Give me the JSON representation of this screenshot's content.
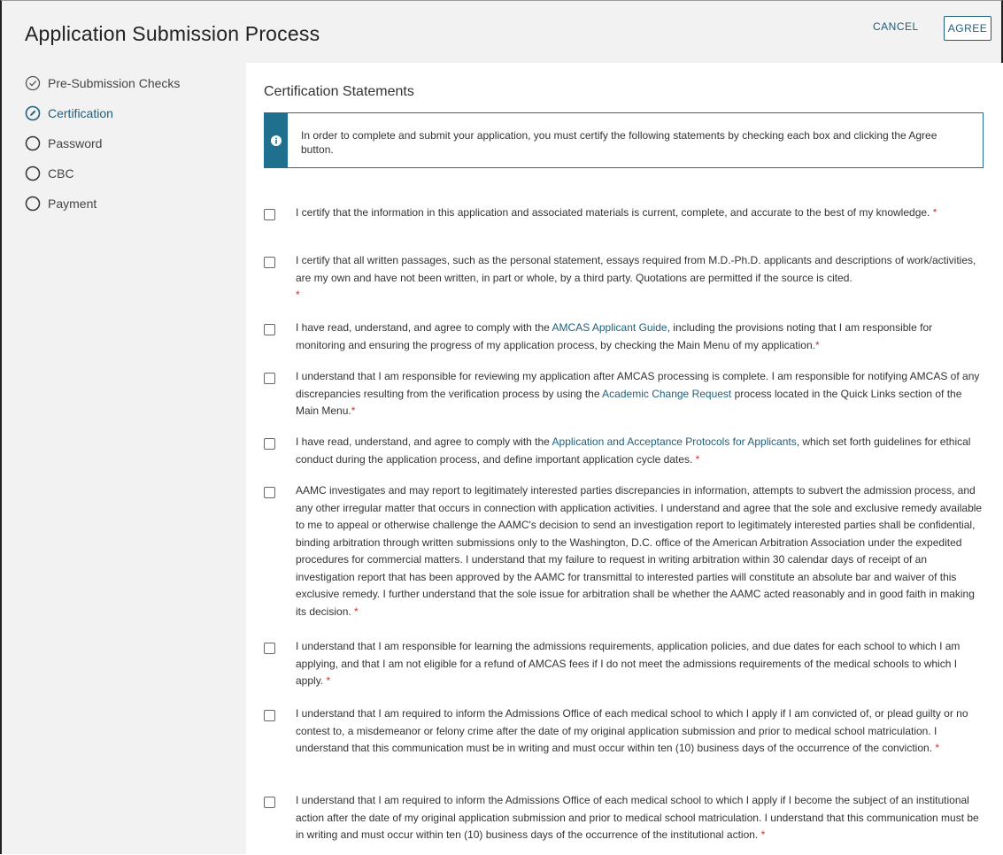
{
  "header": {
    "title": "Application Submission Process",
    "cancel_label": "CANCEL",
    "agree_label": "AGREE"
  },
  "sidebar": {
    "steps": [
      {
        "label": "Pre-Submission Checks",
        "state": "complete",
        "icon": "check-circle-icon"
      },
      {
        "label": "Certification",
        "state": "current",
        "icon": "pencil-circle-icon"
      },
      {
        "label": "Password",
        "state": "pending",
        "icon": "circle-icon"
      },
      {
        "label": "CBC",
        "state": "pending",
        "icon": "circle-icon"
      },
      {
        "label": "Payment",
        "state": "pending",
        "icon": "circle-icon"
      }
    ]
  },
  "main": {
    "section_title": "Certification Statements",
    "info_icon": "info-icon",
    "info_text": "In order to complete and submit your application, you must certify the following statements by checking each box and clicking the Agree button.",
    "required_mark": "*",
    "statements": [
      {
        "text": "I certify that the information in this application and associated materials is current, complete, and accurate to the best of my knowledge. ",
        "checked": false
      },
      {
        "text": "I certify that all written passages, such as the personal statement, essays required from M.D.-Ph.D. applicants and descriptions of work/activities, are my own and have not been written, in part or whole, by a third party. Quotations are permitted if the source is cited. ",
        "checked": false
      },
      {
        "text_before": "I have read, understand, and agree to comply with the ",
        "link": "AMCAS Applicant Guide",
        "text_after": ", including the provisions noting that I am responsible for monitoring and ensuring the progress of my application process, by checking the Main Menu of my application.",
        "checked": false
      },
      {
        "text_before": "I understand that I am responsible for reviewing my application after AMCAS processing is complete. I am responsible for notifying AMCAS of any discrepancies resulting from the verification process by using the ",
        "link": "Academic Change Request",
        "text_after": " process located in the Quick Links section of the Main Menu.",
        "checked": false
      },
      {
        "text_before": "I have read, understand, and agree to comply with the ",
        "link": "Application and Acceptance Protocols for Applicants",
        "text_after": ", which set forth guidelines for ethical conduct during the application process, and define important application cycle dates. ",
        "checked": false
      },
      {
        "text": "AAMC investigates and may report to legitimately interested parties discrepancies in information, attempts to subvert the admission process, and any other irregular matter that occurs in connection with application activities. I understand and agree that the sole and exclusive remedy available to me to appeal or otherwise challenge the AAMC's decision to send an investigation report to legitimately interested parties shall be confidential, binding arbitration through written submissions only to the Washington, D.C. office of the American Arbitration Association under the expedited procedures for commercial matters. I understand that my failure to request in writing arbitration within 30 calendar days of receipt of an investigation report that has been approved by the AAMC for transmittal to interested parties will constitute an absolute bar and waiver of this exclusive remedy. I further understand that the sole issue for arbitration shall be whether the AAMC acted reasonably and in good faith in making its decision. ",
        "checked": false
      },
      {
        "text": "I understand that I am responsible for learning the admissions requirements, application policies, and due dates for each school to which I am applying, and that I am not eligible for a refund of AMCAS fees if I do not meet the admissions requirements of the medical schools to which I apply. ",
        "checked": false
      },
      {
        "text": "I understand that I am required to inform the Admissions Office of each medical school to which I apply if I am convicted of, or plead guilty or no contest to, a misdemeanor or felony crime after the date of my original application submission and prior to medical school matriculation. I understand that this communication must be in writing and must occur within ten (10) business days of the occurrence of the conviction. ",
        "checked": false
      },
      {
        "text": "I understand that I am required to inform the Admissions Office of each medical school to which I apply if I become the subject of an institutional action after the date of my original application submission and prior to medical school matriculation. I understand that this communication must be in writing and must occur within ten (10) business days of the occurrence of the institutional action. ",
        "checked": false
      }
    ]
  },
  "colors": {
    "accent": "#1f5f7a",
    "info_bar": "#1f6f8f",
    "required": "#cc3333"
  }
}
